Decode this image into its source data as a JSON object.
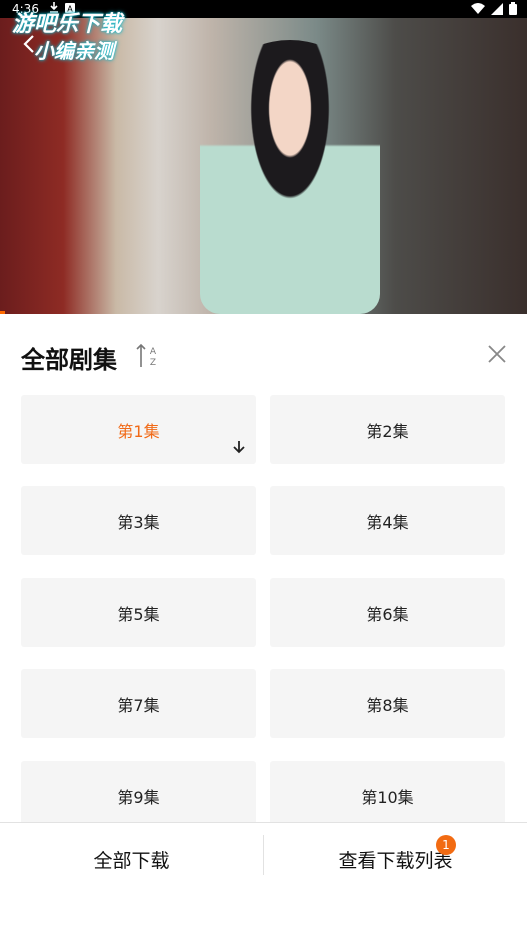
{
  "status_bar": {
    "time": "4:36"
  },
  "video": {
    "watermark_line1": "游吧乐下载",
    "watermark_line2": "小编亲测",
    "progress_fraction": 0.01
  },
  "panel": {
    "title": "全部剧集",
    "sort_icon": "sort-az-icon",
    "close_icon": "close-icon"
  },
  "episodes": [
    {
      "label": "第1集",
      "active": true,
      "downloaded": true
    },
    {
      "label": "第2集"
    },
    {
      "label": "第3集"
    },
    {
      "label": "第4集"
    },
    {
      "label": "第5集"
    },
    {
      "label": "第6集"
    },
    {
      "label": "第7集"
    },
    {
      "label": "第8集"
    },
    {
      "label": "第9集"
    },
    {
      "label": "第10集"
    }
  ],
  "bottom_bar": {
    "download_all": "全部下载",
    "view_list": "查看下载列表",
    "badge_count": "1"
  },
  "colors": {
    "accent": "#f16a17",
    "badge": "#f26b12"
  }
}
